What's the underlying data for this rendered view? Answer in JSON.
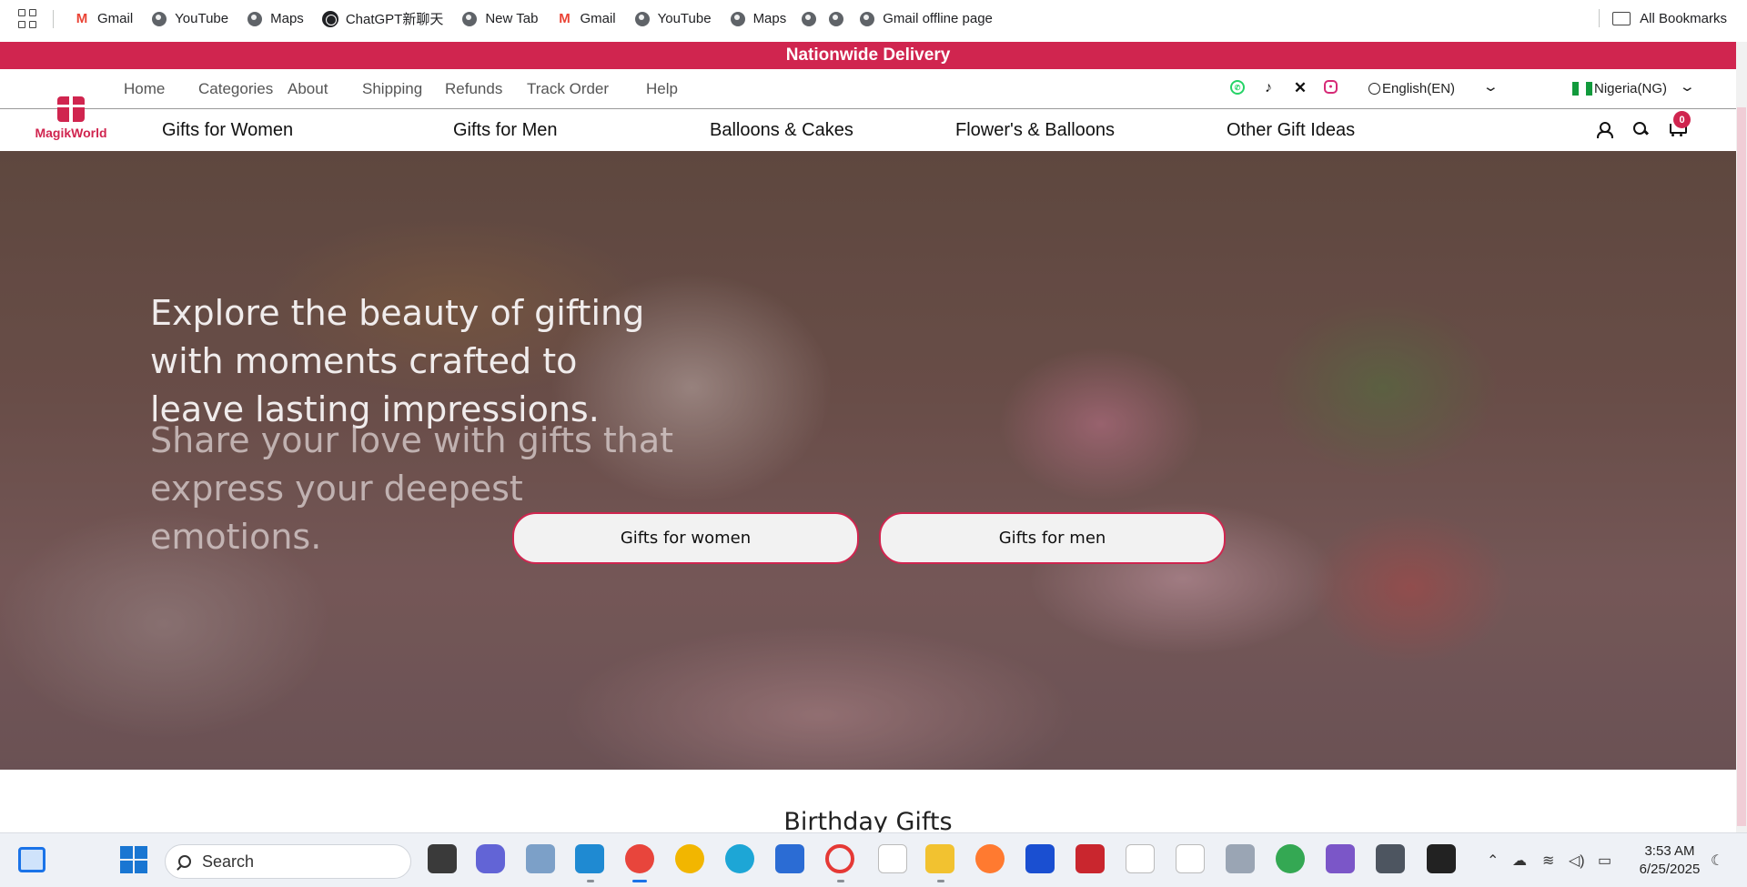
{
  "bookmarks": {
    "items": [
      {
        "label": "Gmail",
        "icon": "gmail-icon"
      },
      {
        "label": "YouTube",
        "icon": "globe-icon"
      },
      {
        "label": "Maps",
        "icon": "globe-icon"
      },
      {
        "label": "ChatGPT新聊天",
        "icon": "chatgpt-icon"
      },
      {
        "label": "New Tab",
        "icon": "globe-icon"
      },
      {
        "label": "Gmail",
        "icon": "gmail-icon"
      },
      {
        "label": "YouTube",
        "icon": "globe-icon"
      },
      {
        "label": "Maps",
        "icon": "globe-icon"
      },
      {
        "label": "",
        "icon": "globe-icon"
      },
      {
        "label": "",
        "icon": "globe-icon"
      },
      {
        "label": "Gmail offline page",
        "icon": "globe-icon"
      }
    ],
    "all_bookmarks": "All Bookmarks"
  },
  "site": {
    "promo": "Nationwide Delivery",
    "top_links": [
      "Home",
      "Categories",
      "About",
      "Shipping",
      "Refunds",
      "Track Order",
      "Help"
    ],
    "language": "English(EN)",
    "country": "Nigeria(NG)",
    "logo_text": "MagikWorld",
    "categories": [
      "Gifts for Women",
      "Gifts for Men",
      "Balloons & Cakes",
      "Flower's & Balloons",
      "Other Gift Ideas"
    ],
    "cart_count": "0",
    "hero": {
      "headline": "Explore the beauty of gifting with moments crafted to leave lasting impressions.",
      "subline": "Share your love with gifts that express your deepest emotions.",
      "button_women": "Gifts for women",
      "button_men": "Gifts for men"
    },
    "section_title": "Birthday Gifts"
  },
  "taskbar": {
    "search_placeholder": "Search",
    "time": "3:53 AM",
    "date": "6/25/2025"
  },
  "colors": {
    "brand": "#d0254f"
  }
}
